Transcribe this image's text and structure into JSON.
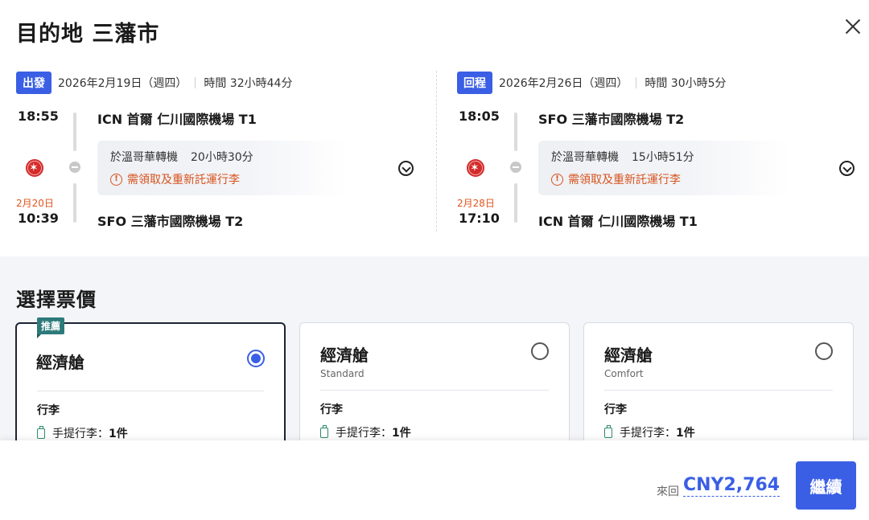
{
  "header": {
    "title": "目的地 三藩市",
    "close_icon": "close-icon"
  },
  "legs": [
    {
      "tag": "出發",
      "date": "2026年2月19日（週四）",
      "duration": "時間 32小時44分",
      "depart_time": "18:55",
      "depart_airport": "ICN 首爾 仁川國際機場 T1",
      "layover_city": "於溫哥華轉機",
      "layover_duration": "20小時30分",
      "warning": "需領取及重新託運行李",
      "arrive_date": "2月20日",
      "arrive_time": "10:39",
      "arrive_airport": "SFO 三藩市國際機場 T2"
    },
    {
      "tag": "回程",
      "date": "2026年2月26日（週四）",
      "duration": "時間 30小時5分",
      "depart_time": "18:05",
      "depart_airport": "SFO 三藩市國際機場 T2",
      "layover_city": "於溫哥華轉機",
      "layover_duration": "15小時51分",
      "warning": "需領取及重新託運行李",
      "arrive_date": "2月28日",
      "arrive_time": "17:10",
      "arrive_airport": "ICN 首爾 仁川國際機場 T1"
    }
  ],
  "fares": {
    "title": "選擇票價",
    "cards": [
      {
        "badge": "推薦",
        "name": "經濟艙",
        "sub": "",
        "baggage_heading": "行李",
        "bag_label": "手提行李：",
        "bag_count": "1件",
        "selected": true
      },
      {
        "badge": "",
        "name": "經濟艙",
        "sub": "Standard",
        "baggage_heading": "行李",
        "bag_label": "手提行李：",
        "bag_count": "1件",
        "selected": false
      },
      {
        "badge": "",
        "name": "經濟艙",
        "sub": "Comfort",
        "baggage_heading": "行李",
        "bag_label": "手提行李：",
        "bag_count": "1件",
        "selected": false
      }
    ]
  },
  "footer": {
    "total_label": "來回",
    "total_price": "CNY2,764",
    "continue_label": "繼續"
  },
  "colors": {
    "accent": "#3a5fe5",
    "warning": "#d8531e",
    "badge": "#2d7a7a"
  }
}
